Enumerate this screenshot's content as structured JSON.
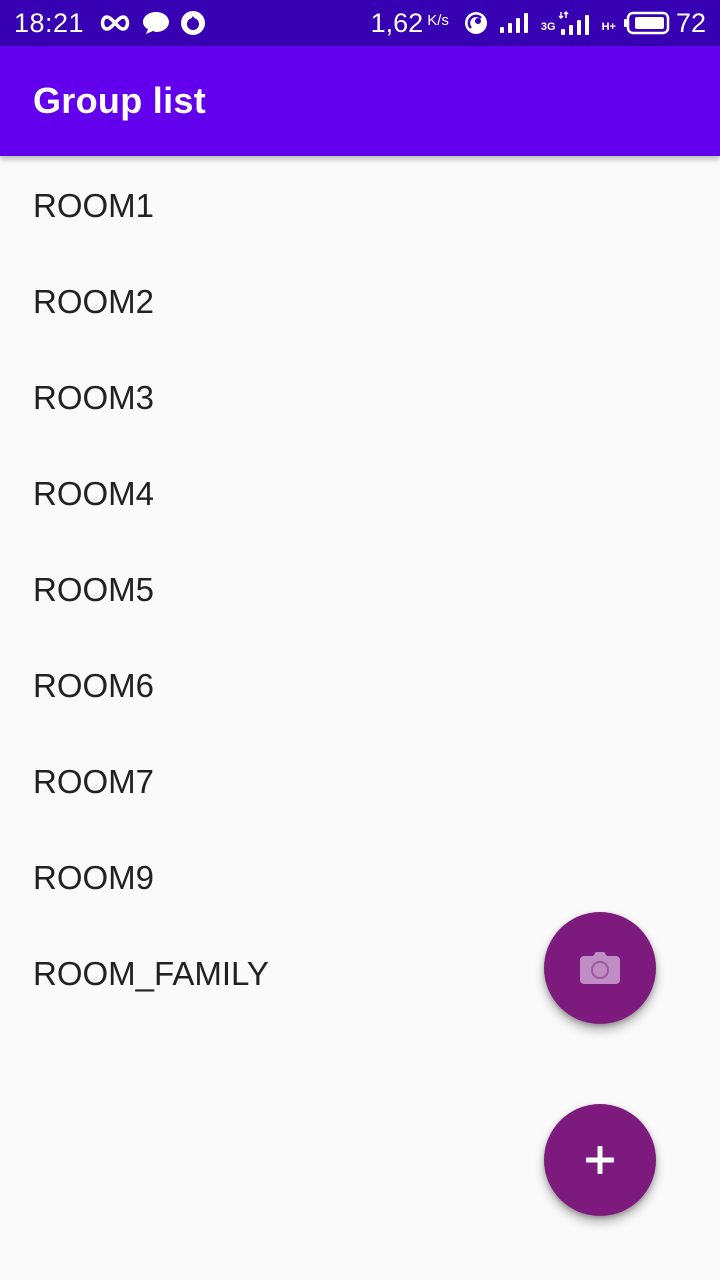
{
  "status_bar": {
    "time": "18:21",
    "net_speed": "1,62",
    "net_speed_unit": "K/s",
    "network_type_1": "3G",
    "network_type_2": "H+",
    "battery": "72",
    "icons": [
      "infinity-icon",
      "chat-bubble-icon",
      "app-notification-icon",
      "hotspot-icon",
      "signal-icon",
      "signal-icon-2",
      "battery-icon"
    ]
  },
  "app_bar": {
    "title": "Group list"
  },
  "groups": [
    "ROOM1",
    "ROOM2",
    "ROOM3",
    "ROOM4",
    "ROOM5",
    "ROOM6",
    "ROOM7",
    "ROOM9",
    "ROOM_FAMILY"
  ],
  "fabs": {
    "camera_icon": "camera-icon",
    "add_icon": "plus-icon"
  },
  "colors": {
    "status_bar": "#3700b3",
    "app_bar": "#6200ee",
    "fab": "#7d1a7e",
    "background": "#fafafa",
    "text": "#212121"
  }
}
